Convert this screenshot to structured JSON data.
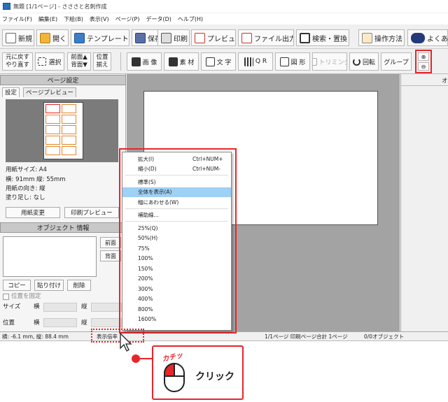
{
  "window": {
    "title": "無題 [1/1ページ] - さささと名刺作成"
  },
  "menubar": [
    "ファイル(F)",
    "編集(E)",
    "下絵(B)",
    "表示(V)",
    "ページ(P)",
    "データ(D)",
    "ヘルプ(H)"
  ],
  "toolbar1": {
    "new": "新規",
    "open": "開く",
    "template": "テンプレート",
    "save": "保存",
    "print": "印刷",
    "preview": "プレビュー",
    "export": "ファイル出力",
    "search_replace": "検索・置換",
    "howto": "操作方法",
    "more": "よくあ"
  },
  "toolbar2": {
    "undo_line1": "元に戻す",
    "undo_line2": "やり直す",
    "select": "選択",
    "front_line1": "前面▲",
    "front_line2": "背面▼",
    "align_line1": "位置",
    "align_line2": "揃え",
    "image": "画 像",
    "material": "素 材",
    "text": "文 字",
    "qr": "Q R",
    "shape": "図 形",
    "trimming": "トリミング",
    "rotate": "回転",
    "group": "グループ"
  },
  "page_settings": {
    "header": "ページ設定",
    "tabs": [
      "設定",
      "ページプレビュー"
    ],
    "paper_size": "用紙サイズ: A4",
    "dimensions": "横: 91mm  縦: 55mm",
    "orientation": "用紙の向き: 縦",
    "bleed": "塗り足し: なし",
    "change_paper": "用紙変更",
    "print_preview": "印刷プレビュー"
  },
  "object_info": {
    "header": "オブジェクト 情報",
    "bring_front": "前面",
    "send_back": "背面",
    "copy": "コピー",
    "paste": "貼り付け",
    "delete": "削除",
    "fix_position": "位置を固定",
    "size_label": "サイズ",
    "width_label": "横",
    "height_label": "縦",
    "position_label": "位置"
  },
  "right_panel_header": "オ",
  "context_menu": {
    "items": [
      {
        "label": "拡大(I)",
        "shortcut": "Ctrl+NUM+"
      },
      {
        "label": "縮小(D)",
        "shortcut": "Ctrl+NUM-"
      },
      {
        "label": "標準(S)",
        "shortcut": ""
      },
      {
        "label": "全体を表示(A)",
        "shortcut": ""
      },
      {
        "label": "幅にあわせる(W)",
        "shortcut": ""
      },
      {
        "label": "補助線...",
        "shortcut": ""
      },
      {
        "label": "25%(Q)",
        "shortcut": ""
      },
      {
        "label": "50%(H)",
        "shortcut": ""
      },
      {
        "label": "75%",
        "shortcut": ""
      },
      {
        "label": "100%",
        "shortcut": ""
      },
      {
        "label": "150%",
        "shortcut": ""
      },
      {
        "label": "200%",
        "shortcut": ""
      },
      {
        "label": "300%",
        "shortcut": ""
      },
      {
        "label": "400%",
        "shortcut": ""
      },
      {
        "label": "800%",
        "shortcut": ""
      },
      {
        "label": "1600%",
        "shortcut": ""
      }
    ],
    "highlighted_item": "全体を表示(A)"
  },
  "statusbar": {
    "coords": "横: -6.1 mm, 縦: 88.4 mm",
    "zoom": "表示倍率",
    "pages": "1/1ページ 印刷ページ合計 1ページ",
    "objects": "0/0オブジェクト"
  },
  "callout": {
    "click_sound": "カチッ",
    "label": "クリック"
  },
  "colors": {
    "accent_red": "#e8252a",
    "highlight": "#9fd0f5",
    "canvas_bg": "#a3a3a3",
    "guide_orange": "#e2872c"
  }
}
